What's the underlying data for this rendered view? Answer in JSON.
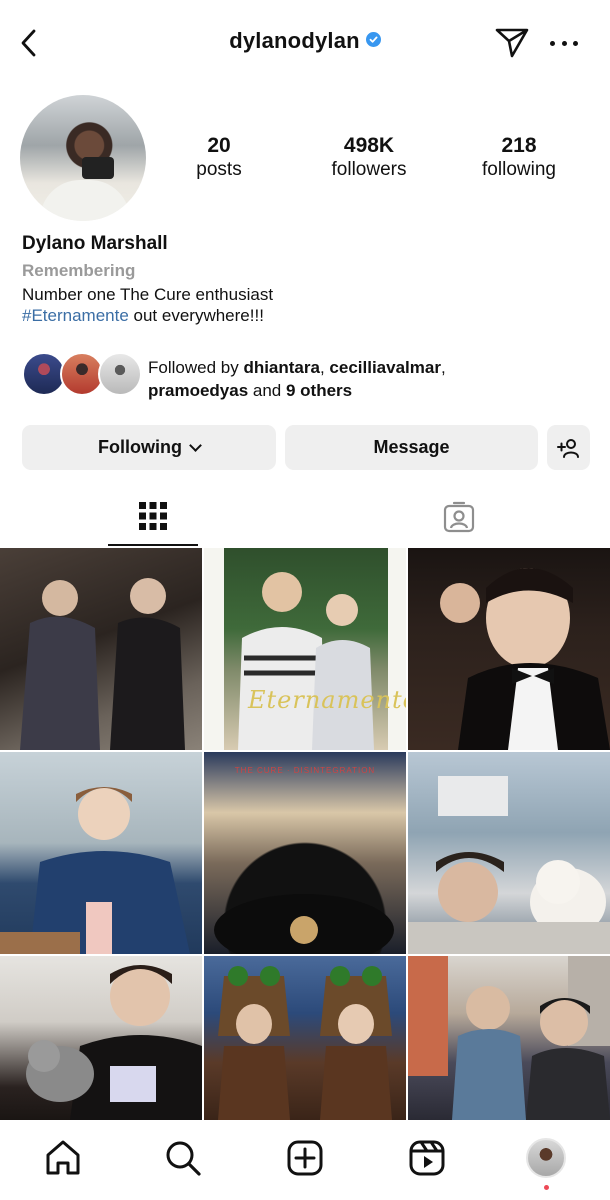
{
  "header": {
    "username": "dylanodylan",
    "verified": true,
    "accent_color": "#3897f0"
  },
  "profile": {
    "display_name": "Dylano Marshall",
    "category": "Remembering",
    "bio_line1": "Number one The Cure enthusiast",
    "bio_hashtag": "#Eternamente",
    "bio_line2_rest": " out everywhere!!!",
    "hashtag_color": "#3b6ea5"
  },
  "stats": [
    {
      "value": "20",
      "label": "posts"
    },
    {
      "value": "498K",
      "label": "followers"
    },
    {
      "value": "218",
      "label": "following"
    }
  ],
  "followed_by": {
    "prefix": "Followed by ",
    "name1": "dhiantara",
    "sep1": ", ",
    "name2": "cecilliavalmar",
    "sep2": ",",
    "name3": "pramoedyas",
    "and": " and ",
    "others": "9 others"
  },
  "actions": {
    "following_label": "Following",
    "message_label": "Message"
  },
  "tabs": [
    {
      "name": "posts-grid",
      "icon": "grid-icon",
      "active": true
    },
    {
      "name": "tagged",
      "icon": "tagged-person-icon",
      "active": false
    }
  ],
  "grid": {
    "poster_title": "Eternamente",
    "vinyl_label": "THE CURE · DISINTEGRATION"
  },
  "nav": {
    "items": [
      "home-icon",
      "search-icon",
      "create-icon",
      "reels-icon",
      "profile-avatar"
    ],
    "notification_dot_color": "#ed4956"
  }
}
